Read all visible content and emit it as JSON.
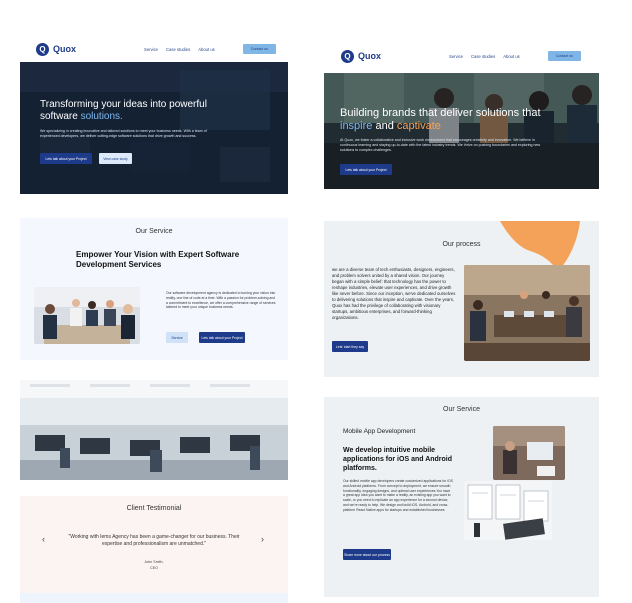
{
  "colors": {
    "brand": "#1e3a8a",
    "accent": "#7fb6e6",
    "highlight": "#7db9f0",
    "orange": "#f4a259"
  },
  "left": {
    "nav": {
      "logo_letter": "Q",
      "logo": "Quox",
      "links": [
        "Service",
        "Case studies",
        "About us"
      ],
      "cta": "Contact us"
    },
    "hero": {
      "title_line1": "Transforming your ideas into powerful",
      "title_plain": "software ",
      "title_accent": "solutions.",
      "body": "We specializing in creating innovative and tailored solutions to meet your business needs. With a team of experienced developers, we deliver cutting-edge software solutions that drive growth and success.",
      "btn_primary": "Lets talk about your Project",
      "btn_secondary": "View case study"
    },
    "service": {
      "label": "Our Service",
      "title": "Empower Your Vision with Expert Software Development Services",
      "body": "Our software development agency is dedicated to turning your vision into reality, one line of code at a time. With a passion for problem-solving and a commitment to excellence, we offer a comprehensive range of services tailored to meet your unique business needs.",
      "btn_primary": "Service",
      "btn_secondary": "Lets talk about your Project"
    },
    "testimonial": {
      "label": "Client Testimonial",
      "quote": "\"Working with Iems Agency has been a game-changer for our business. Their expertise and professionalism are unmatched.\"",
      "author": "John Smith,",
      "role": "CEO",
      "prev": "‹",
      "next": "›"
    }
  },
  "right": {
    "nav": {
      "logo_letter": "Q",
      "logo": "Quox",
      "links": [
        "Service",
        "Case studies",
        "About us"
      ],
      "cta": "Contact us"
    },
    "hero": {
      "title_line1": "Building brands that deliver solutions that",
      "title_accent1": "inspire",
      "title_and": " and ",
      "title_accent2": "captivate",
      "body": "At Quox, we foster a collaborative and inclusive work environment that encourages creativity and innovation. We believe in continuous learning and staying up-to-date with the latest industry trends. We thrive on pushing boundaries and exploring new solutions to complex challenges.",
      "btn": "Lets talk about your Project"
    },
    "process": {
      "label": "Our process",
      "body": "we are a diverse team of tech enthusiasts, designers, engineers, and problem solvers united by a shared vision. Our journey began with a simple belief: that technology has the power to reshape industries, elevate user experiences, and drive growth like never before. Since our inception, we've dedicated ourselves to delivering solutions that inspire and captivate. Over the years, Quox has had the privilege of collaborating with visionary startups, ambitious enterprises, and forward-thinking organizations.",
      "btn": "Lets’ start they say"
    },
    "service": {
      "label": "Our Service",
      "subtitle": "Mobile App Development",
      "title": "We develop intuitive mobile applications for iOS and Android platforms.",
      "body": "Our skilled mobile app developers create customized applications for iOS and Android platforms. From concept to deployment, we ensure smooth functionality, engaging designs, and optimal user experiences.You have a great app idea you want to make a reality, an existing app you want to scale, or you need to replicate an app experience for a second device, and we're ready to help. We design and build iOS, Android, and cross-platform React Native apps for startups and established businesses.",
      "btn": "Share more about our process"
    }
  }
}
